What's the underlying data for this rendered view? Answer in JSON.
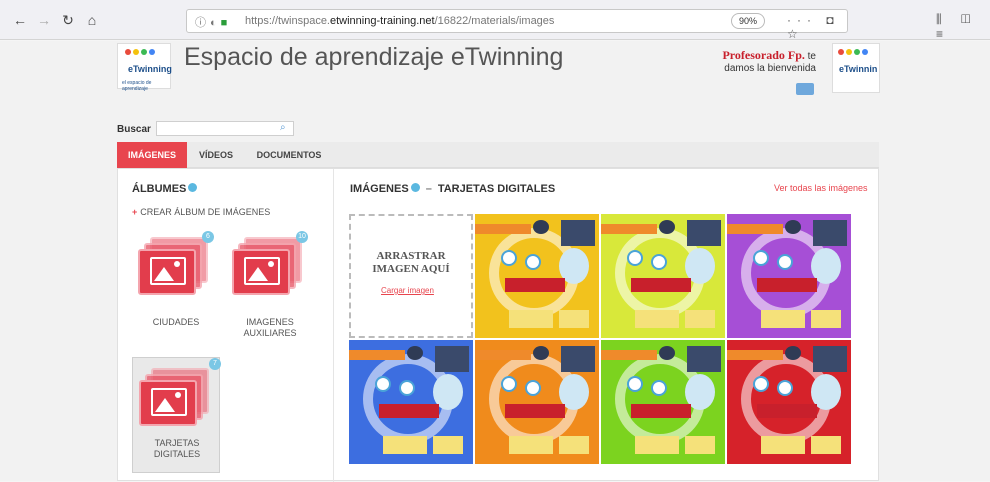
{
  "browser": {
    "back_icon": "back-arrow-icon",
    "url_prefix": "https://twinspace.",
    "url_domain": "etwinning-training.net",
    "url_suffix": "/16822/materials/images",
    "zoom": "90%",
    "menu_dots": "···"
  },
  "header": {
    "site_title": "Espacio de aprendizaje eTwinning",
    "logo_word": "eTwinning",
    "logo_sub": "el espacio de aprendizaje",
    "welcome_name": "Profesorado Fp.",
    "welcome_suffix": "te",
    "welcome_text": "damos la bienvenida",
    "right_logo_word": "eTwinnin"
  },
  "search": {
    "label": "Buscar",
    "value": ""
  },
  "tabs": [
    {
      "label": "IMÁGENES",
      "active": true
    },
    {
      "label": "VÍDEOS",
      "active": false
    },
    {
      "label": "DOCUMENTOS",
      "active": false
    }
  ],
  "albums": {
    "title": "ÁLBUMES",
    "create_label": "CREAR ÁLBUM DE IMÁGENES",
    "items": [
      {
        "label": "CIUDADES",
        "label2": "",
        "count": "6"
      },
      {
        "label": "IMAGENES",
        "label2": "AUXILIARES",
        "count": "10"
      },
      {
        "label": "TARJETAS",
        "label2": "DIGITALES",
        "count": "7"
      }
    ]
  },
  "images": {
    "title": "IMÁGENES",
    "album_name": "TARJETAS DIGITALES",
    "see_all": "Ver todas las imágenes",
    "drop_text": "ARRASTRAR IMAGEN AQUÍ",
    "upload_label": "Cargar imagen",
    "thumbnails": [
      {
        "color": "#f2c21d"
      },
      {
        "color": "#d8e83a"
      },
      {
        "color": "#a64fd6"
      },
      {
        "color": "#3d6ee0"
      },
      {
        "color": "#f08b1c"
      },
      {
        "color": "#7cd31f"
      },
      {
        "color": "#d6222a"
      }
    ]
  }
}
